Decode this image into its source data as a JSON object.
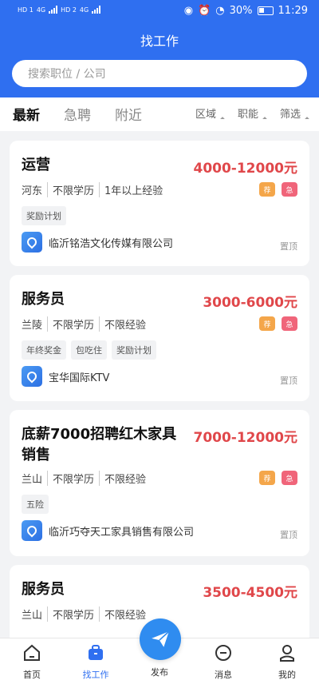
{
  "status": {
    "left1": "HD 1",
    "left2": "HD 2",
    "sig1": "4G",
    "sig2": "4G",
    "battery": "30%",
    "time": "11:29"
  },
  "header": {
    "title": "找工作",
    "search_placeholder": "搜索职位 / 公司"
  },
  "tabs": [
    "最新",
    "急聘",
    "附近"
  ],
  "filters": [
    "区域",
    "职能",
    "筛选"
  ],
  "jobs": [
    {
      "title_line1": "运营",
      "title_line2": "",
      "salary": "4000-12000元",
      "location": "河东",
      "education": "不限学历",
      "experience": "1年以上经验",
      "tags": [
        "奖励计划",
        "",
        ""
      ],
      "badge_rec": "荐",
      "badge_urg": "急",
      "company": "临沂铭浩文化传媒有限公司",
      "pin": "置顶"
    },
    {
      "title_line1": "服务员",
      "title_line2": "",
      "salary": "3000-6000元",
      "location": "兰陵",
      "education": "不限学历",
      "experience": "不限经验",
      "tags": [
        "年终奖金",
        "包吃住",
        "奖励计划"
      ],
      "badge_rec": "荐",
      "badge_urg": "急",
      "company": "宝华国际KTV",
      "pin": "置顶"
    },
    {
      "title_line1": "底薪7000招聘红木家具",
      "title_line2": "销售",
      "salary": "7000-12000元",
      "location": "兰山",
      "education": "不限学历",
      "experience": "不限经验",
      "tags": [
        "五险",
        "",
        ""
      ],
      "badge_rec": "荐",
      "badge_urg": "急",
      "company": "临沂巧夺天工家具销售有限公司",
      "pin": "置顶"
    },
    {
      "title_line1": "服务员",
      "title_line2": "",
      "salary": "3500-4500元",
      "location": "兰山",
      "education": "不限学历",
      "experience": "不限经验"
    }
  ],
  "tabbar": [
    "首页",
    "找工作",
    "发布",
    "消息",
    "我的"
  ],
  "colors": {
    "primary": "#2f6ff0",
    "salary": "#e0474a",
    "recommend": "#f4a64a",
    "urgent": "#f0657a"
  }
}
